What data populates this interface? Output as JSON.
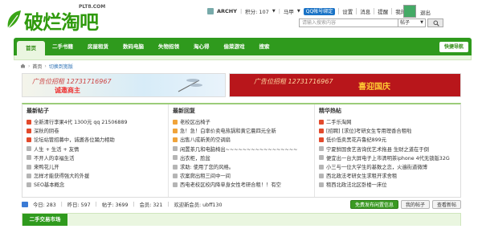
{
  "logo": {
    "main": "破烂淘吧",
    "sub": "PLT8.COM"
  },
  "userbar": {
    "username": "ARCHY",
    "points_label": "积分: 107",
    "horse_label": "马甲",
    "qq_label": "QQ帐号绑定",
    "settings": "设置",
    "messages": "消息",
    "reminders": "提醒",
    "admin": "我的管理",
    "logout": "退出"
  },
  "search": {
    "placeholder": "请输入搜索内容",
    "scope": "帖子"
  },
  "nav": {
    "items": [
      "首页",
      "二手书籍",
      "房屋租赁",
      "数码电脑",
      "失物招领",
      "淘心得",
      "偷菜游戏",
      "搜索"
    ],
    "quick": "快捷导航"
  },
  "breadcrumb": {
    "home": "首页",
    "current": "切换到宽版"
  },
  "banners": {
    "left_title": "广告位招租 12731716967",
    "left_sub": "诚邀商主",
    "right_title": "广告位招租 12731716967",
    "right_badge": "喜迎国庆"
  },
  "columns": [
    {
      "title": "最新帖子",
      "items": [
        "全新清行李果4代 1300元 qq 21506889",
        "深秋的阴卷",
        "论坛站管招募中，诚邀各位踊力相助",
        "人生 + 生活 + 友情",
        "不开人的幸福生活",
        "来鸭花儿开",
        "怎样才能获得强大的外援",
        "SEO基本概念"
      ]
    },
    {
      "title": "最新回复",
      "items": [
        "老校区出椅子",
        "急！急！白率价卖电热锅和黄它晨四元全新",
        "出售八成新美的空调扇",
        "闲置茶几和电脑椅出~~~~~~~~~~~~~~~~~",
        "出衣柜，脸盆",
        "求助: 使用了您的风格。",
        "农案爬出租三间中一间",
        "西电老校区校内降单身女性考研合租！！有空"
      ]
    },
    {
      "title": "精华热帖",
      "items": [
        "二手乐淘网",
        "[招聘] [求位]考研女生专用理香合租啦",
        "低价低卖黑花卉鲁纪899元",
        "宁夏鲜国食艺咨询优艺术拖县 生财之道在于倒",
        "便宜出一台大屏电子上市清明茶iphone 4代无锁版32G",
        "小三与一位大学生的基数之恋，火遍街道微博",
        "西北政法考研女生求租开求舍租",
        "租西北政法北区卧楼一床位"
      ]
    }
  ],
  "stats": {
    "today": "今日: 283",
    "yesterday": "昨日: 597",
    "posts": "帖子: 3699",
    "members": "会员: 321",
    "welcome": "欢迎新会员: ubff130"
  },
  "buttons": {
    "free_post": "免费发布闲置信息",
    "my_posts": "我的帖子",
    "view_new": "查看新帖"
  },
  "market": {
    "tab": "二手交易市场"
  },
  "colors": {
    "brand": "#2f9a1d",
    "accent_red": "#e24a2c",
    "link": "#2a6fb3"
  }
}
